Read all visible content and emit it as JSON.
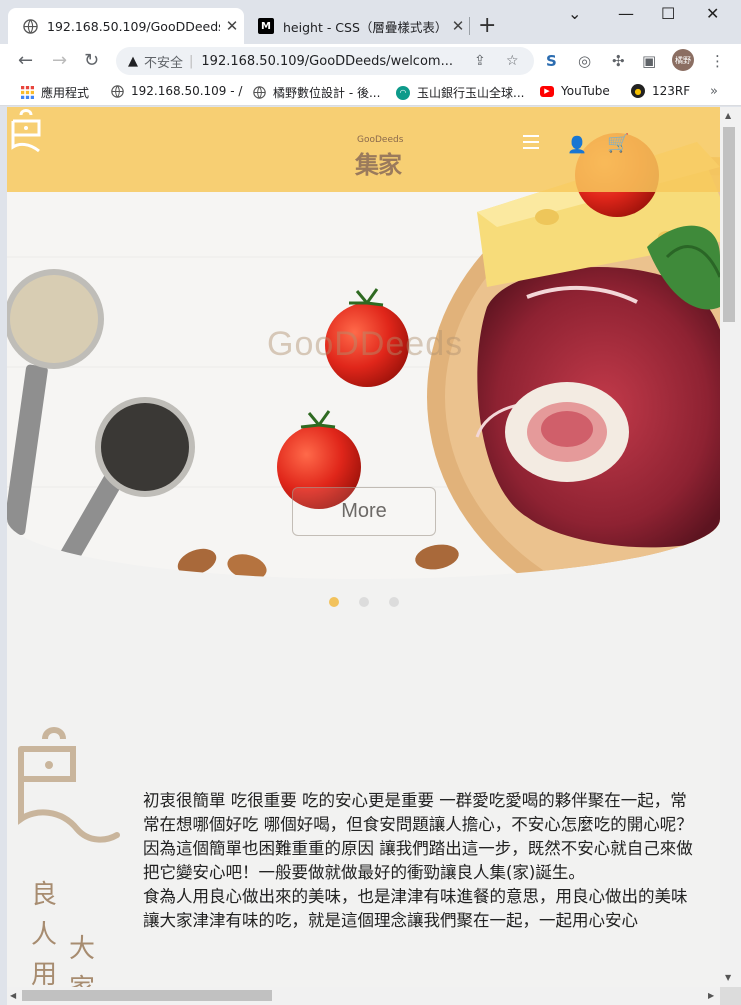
{
  "browser": {
    "tabs": [
      {
        "title": "192.168.50.109/GooDDeeds/",
        "active": true,
        "favicon": "globe-icon"
      },
      {
        "title": "height - CSS（層疊樣式表）|",
        "active": false,
        "favicon": "mdn-icon"
      }
    ],
    "address": {
      "insecure_label": "不安全",
      "url": "192.168.50.109/GooDDeeds/welcom..."
    },
    "profile_label": "橘野",
    "bookmarks": [
      {
        "label": "應用程式",
        "icon": "apps-grid-icon"
      },
      {
        "label": "192.168.50.109 - /",
        "icon": "globe-icon"
      },
      {
        "label": "橘野數位設計 - 後...",
        "icon": "globe-icon"
      },
      {
        "label": "玉山銀行玉山全球...",
        "icon": "esun-icon"
      },
      {
        "label": "YouTube",
        "icon": "youtube-icon"
      },
      {
        "label": "123RF",
        "icon": "123rf-icon"
      }
    ]
  },
  "site": {
    "logo_en": "GooDeeds",
    "logo_cn": "集家",
    "hero": {
      "watermark": "GooDDeeds",
      "button": "More"
    },
    "carousel": {
      "count": 3,
      "active": 0
    },
    "about": {
      "side_col1": "良人用",
      "side_col2": "大家",
      "paragraphs": [
        "初衷很簡單 吃很重要 吃的安心更是重要 一群愛吃愛喝的夥伴聚在一起，常常在想哪個好吃 哪個好喝，但食安問題讓人擔心，不安心怎麼吃的開心呢？",
        "因為這個簡單也困難重重的原因 讓我們踏出這一步，既然不安心就自己來做把它變安心吧！一般要做就做最好的衝勁讓良人集(家)誕生。",
        "食為人用良心做出來的美味，也是津津有味進餐的意思，用良心做出的美味讓大家津津有味的吃，就是這個理念讓我們聚在一起，一起用心安心"
      ]
    }
  },
  "colors": {
    "header": "#f7c85c",
    "brand_brown": "#a78c70",
    "dot_active": "#f2c25c"
  }
}
